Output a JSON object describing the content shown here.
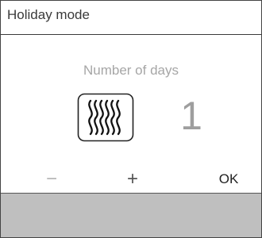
{
  "header": {
    "title": "Holiday mode"
  },
  "main": {
    "subtitle": "Number of days",
    "days_value": "1",
    "mode_icon": "heating-waves-icon"
  },
  "controls": {
    "minus_label": "−",
    "plus_label": "+",
    "ok_label": "OK"
  },
  "colors": {
    "minus_disabled": "#b5b5b5",
    "value_text": "#9e9e9e",
    "footer_bar": "#bfbfbf"
  }
}
